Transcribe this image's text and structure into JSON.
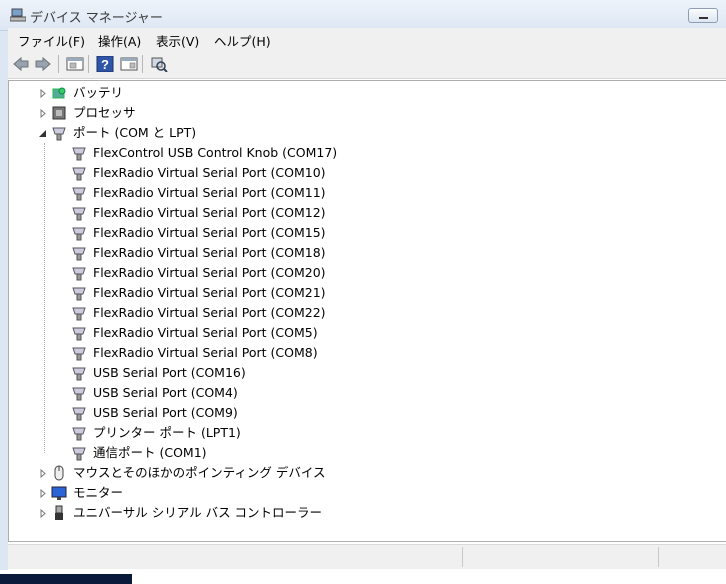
{
  "window": {
    "title": "デバイス マネージャー"
  },
  "menu": [
    {
      "label": "ファイル(F)"
    },
    {
      "label": "操作(A)"
    },
    {
      "label": "表示(V)"
    },
    {
      "label": "ヘルプ(H)"
    }
  ],
  "toolbar": {
    "buttons": [
      {
        "name": "back-arrow-icon"
      },
      {
        "name": "forward-arrow-icon"
      },
      {
        "name": "properties-icon"
      },
      {
        "name": "help-icon"
      },
      {
        "name": "show-hidden-icon"
      },
      {
        "name": "scan-hardware-icon"
      }
    ]
  },
  "tree": {
    "categories": [
      {
        "label": "バッテリ",
        "icon": "battery-icon",
        "expanded": false
      },
      {
        "label": "プロセッサ",
        "icon": "processor-icon",
        "expanded": false
      },
      {
        "label": "ポート (COM と LPT)",
        "icon": "port-icon",
        "expanded": true
      },
      {
        "label": "マウスとそのほかのポインティング デバイス",
        "icon": "mouse-icon",
        "expanded": false
      },
      {
        "label": "モニター",
        "icon": "monitor-icon",
        "expanded": false
      },
      {
        "label": "ユニバーサル シリアル バス コントローラー",
        "icon": "usb-icon",
        "expanded": false
      }
    ],
    "ports": [
      {
        "label": "FlexControl USB Control Knob (COM17)"
      },
      {
        "label": "FlexRadio Virtual Serial Port (COM10)"
      },
      {
        "label": "FlexRadio Virtual Serial Port (COM11)"
      },
      {
        "label": "FlexRadio Virtual Serial Port (COM12)"
      },
      {
        "label": "FlexRadio Virtual Serial Port (COM15)"
      },
      {
        "label": "FlexRadio Virtual Serial Port (COM18)"
      },
      {
        "label": "FlexRadio Virtual Serial Port (COM20)"
      },
      {
        "label": "FlexRadio Virtual Serial Port (COM21)"
      },
      {
        "label": "FlexRadio Virtual Serial Port (COM22)"
      },
      {
        "label": "FlexRadio Virtual Serial Port (COM5)"
      },
      {
        "label": "FlexRadio Virtual Serial Port (COM8)"
      },
      {
        "label": "USB Serial Port (COM16)"
      },
      {
        "label": "USB Serial Port (COM4)"
      },
      {
        "label": "USB Serial Port (COM9)"
      },
      {
        "label": "プリンター ポート (LPT1)"
      },
      {
        "label": "通信ポート (COM1)"
      }
    ]
  },
  "statusbar": {
    "text": ""
  }
}
